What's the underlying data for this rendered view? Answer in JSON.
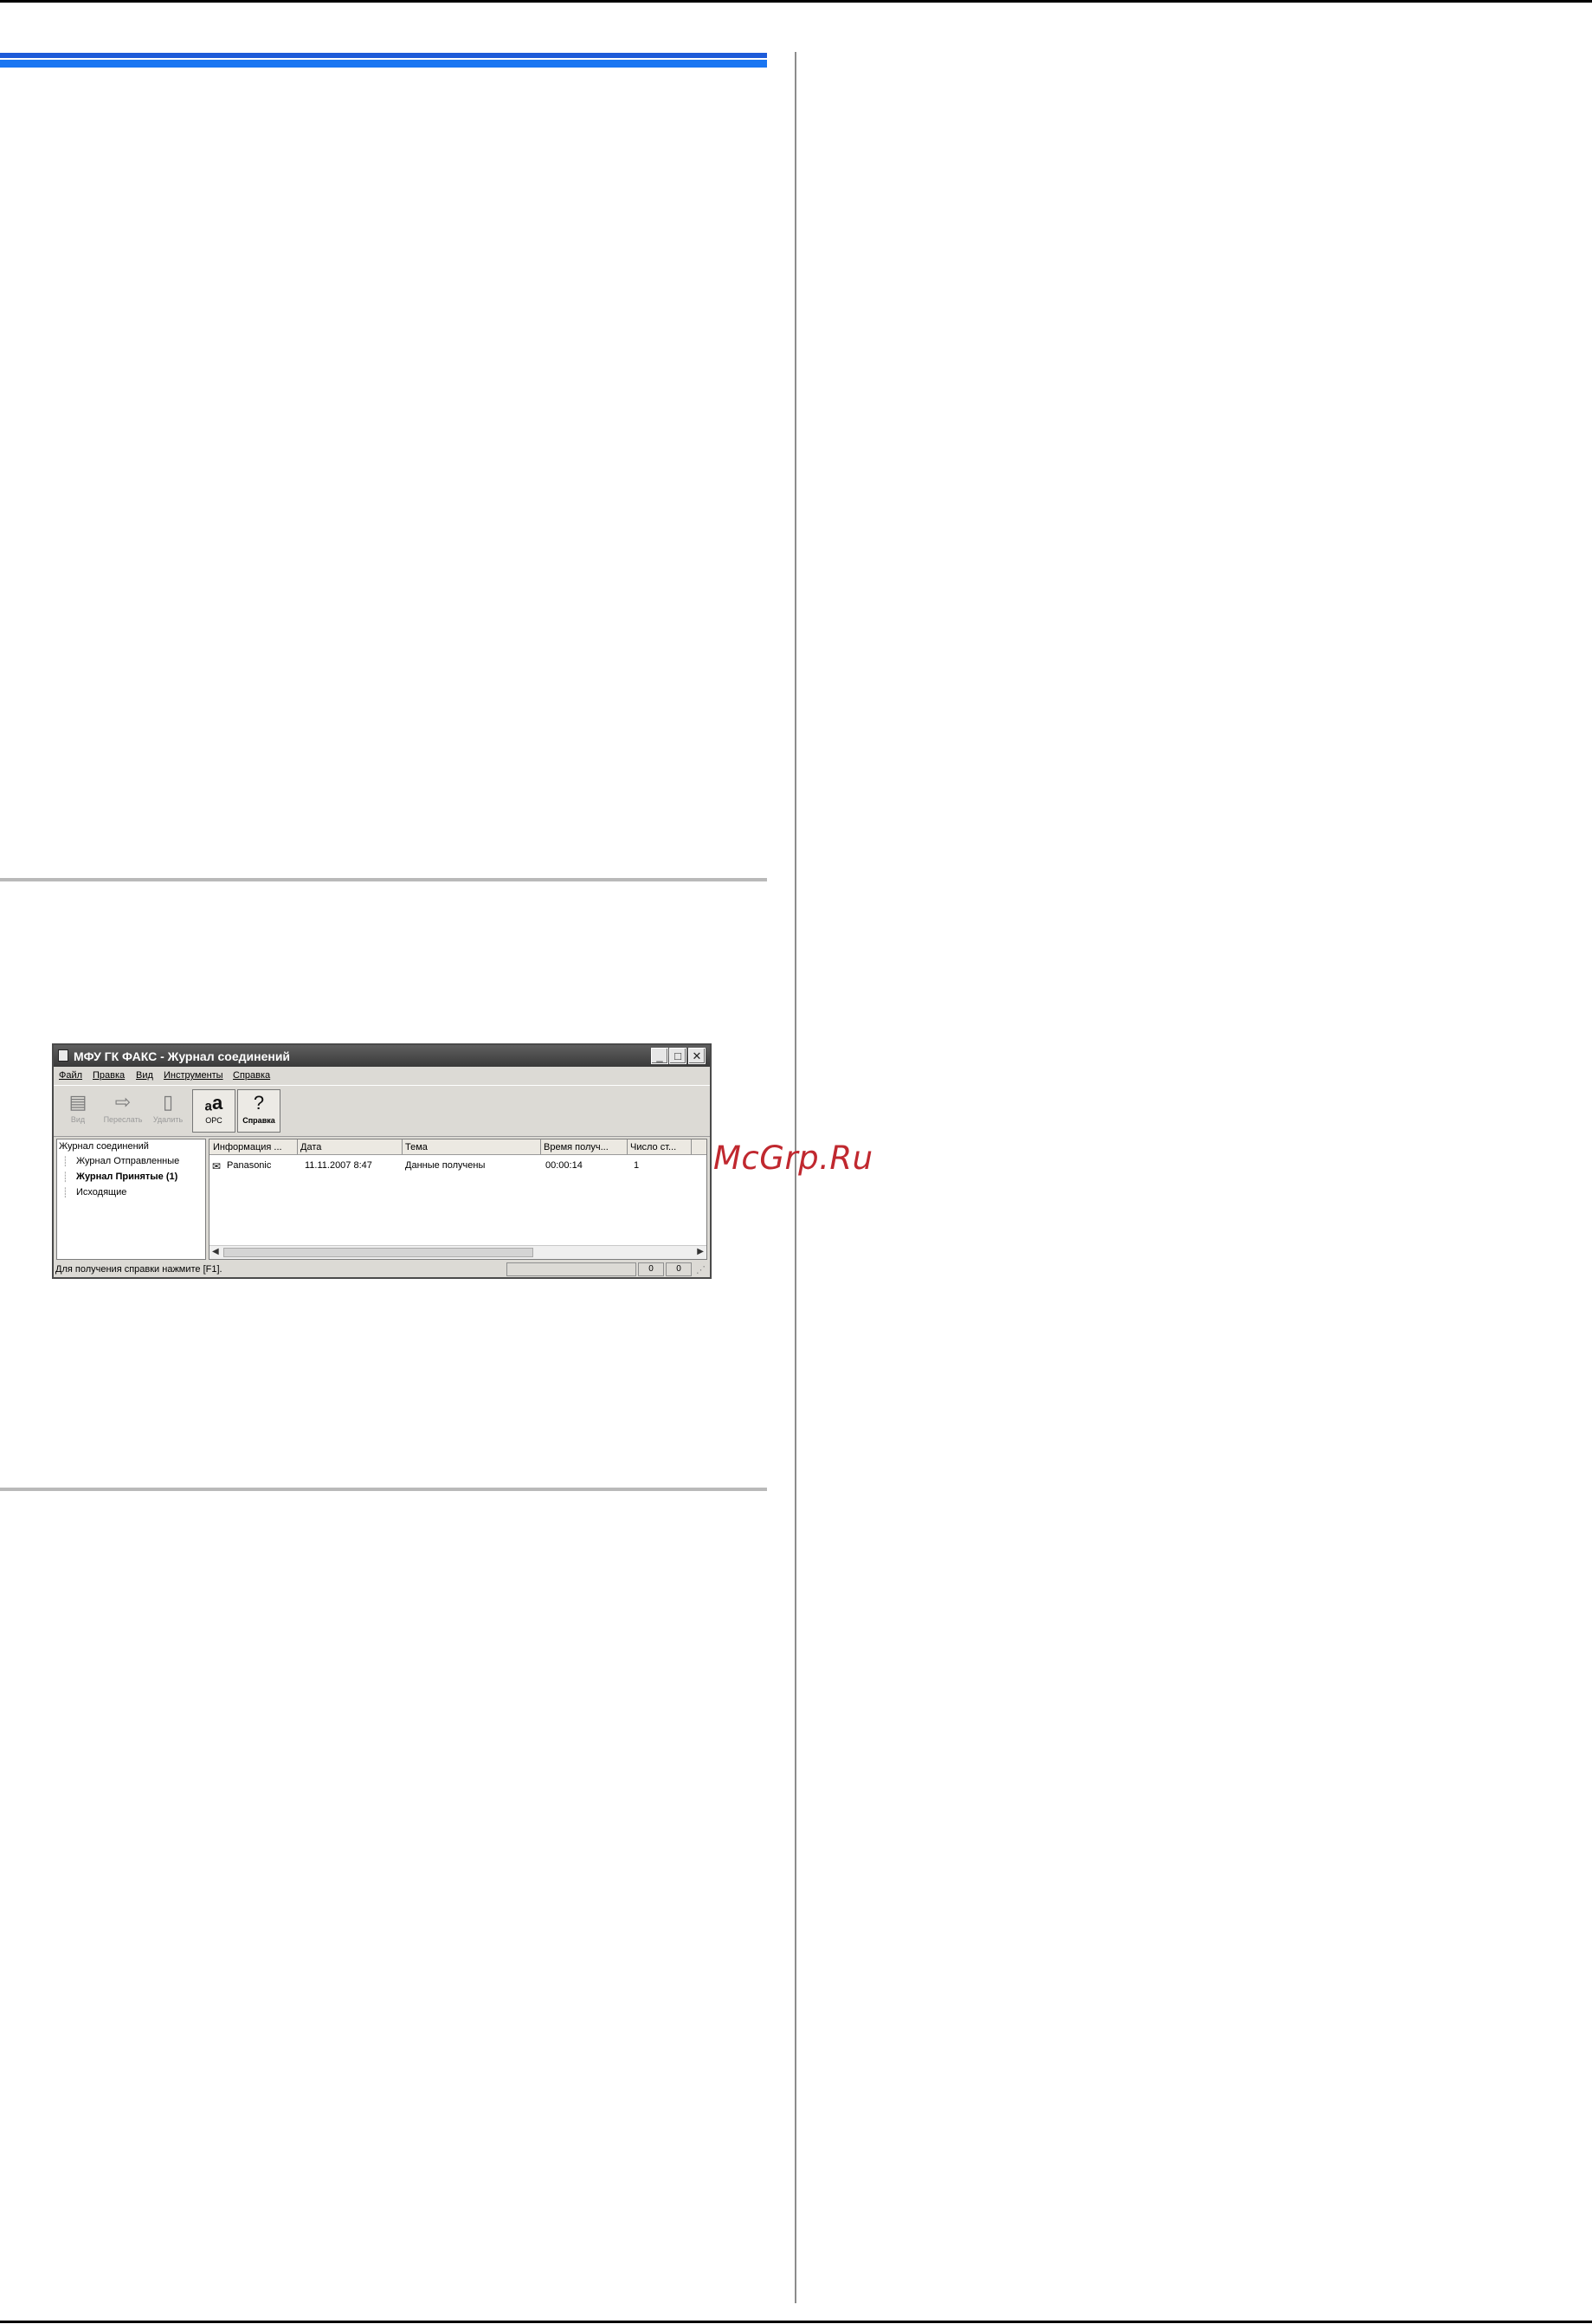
{
  "watermark": "McGrp.Ru",
  "window": {
    "title": "МФУ ГК ФАКС - Журнал соединений",
    "menu": [
      "Файл",
      "Правка",
      "Вид",
      "Инструменты",
      "Справка"
    ],
    "toolbar": [
      {
        "label": "Вид",
        "icon": "view-icon",
        "enabled": false
      },
      {
        "label": "Переслать",
        "icon": "forward-icon",
        "enabled": false
      },
      {
        "label": "Удалить",
        "icon": "delete-icon",
        "enabled": false
      },
      {
        "label": "OPC",
        "icon": "ocr-icon",
        "enabled": true
      },
      {
        "label": "Справка",
        "icon": "help-icon",
        "enabled": true
      }
    ],
    "tree": {
      "root": "Журнал соединений",
      "items": [
        "Журнал Отправленные",
        "Журнал Принятые (1)",
        "Исходящие"
      ],
      "selected": "Журнал Принятые (1)"
    },
    "columns": [
      "Информация ...",
      "Дата",
      "Тема",
      "Время получ...",
      "Число ст..."
    ],
    "rows": [
      {
        "info": "Panasonic",
        "date": "11.11.2007 8:47",
        "subject": "Данные получены",
        "time": "00:00:14",
        "pages": "1"
      }
    ],
    "status": {
      "text": "Для получения справки нажмите [F1].",
      "counter1": "0",
      "counter2": "0"
    }
  }
}
